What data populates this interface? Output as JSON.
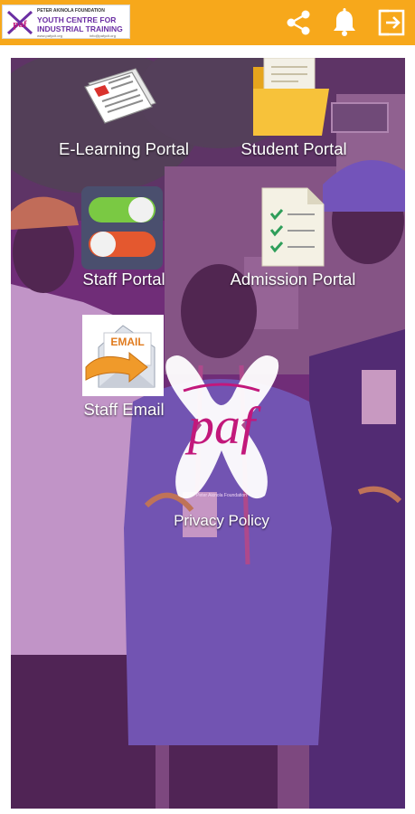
{
  "header": {
    "logo": {
      "line1": "PETER AKINOLA FOUNDATION",
      "line2": "YOUTH CENTRE FOR",
      "line3": "INDUSTRIAL TRAINING",
      "line4": "www.pafycit.org",
      "line5": "info@pafycit.org",
      "mark_text": "paf"
    },
    "icons": [
      "share-icon",
      "bell-icon",
      "logout-icon"
    ],
    "background_color": "#f7a81b"
  },
  "tiles": [
    {
      "label": "E-Learning Portal",
      "icon": "newspaper-icon"
    },
    {
      "label": "Student Portal",
      "icon": "folder-icon"
    },
    {
      "label": "Staff Portal",
      "icon": "toggle-switches-icon"
    },
    {
      "label": "Admission Portal",
      "icon": "checklist-document-icon"
    },
    {
      "label": "Staff Email",
      "icon": "email-envelope-icon",
      "icon_text": "EMAIL"
    }
  ],
  "privacy": {
    "label": "Privacy Policy",
    "mark_text": "paf",
    "subtitle": "Peter Akinola Foundation",
    "icon": "paf-logo-icon"
  },
  "background": {
    "tint_color": "#7a2b8c"
  }
}
